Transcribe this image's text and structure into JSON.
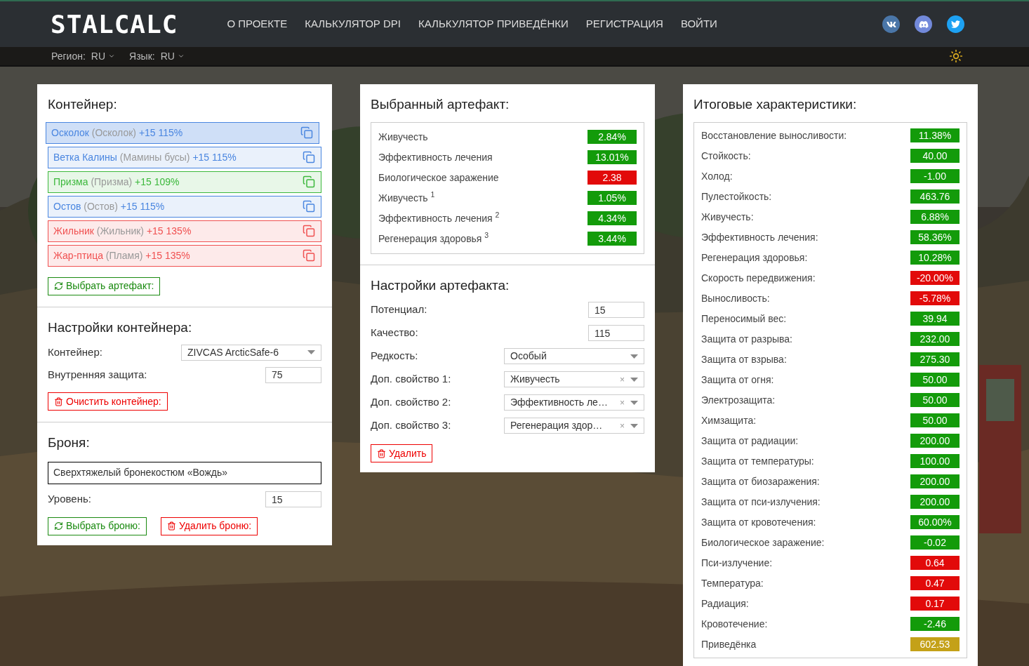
{
  "nav": {
    "logo": "STALCALC",
    "links": [
      "О ПРОЕКТЕ",
      "КАЛЬКУЛЯТОР DPI",
      "КАЛЬКУЛЯТОР ПРИВЕДЁНКИ",
      "РЕГИСТРАЦИЯ",
      "ВОЙТИ"
    ]
  },
  "subbar": {
    "region_label": "Регион:",
    "region": "RU",
    "language_label": "Язык:",
    "language": "RU"
  },
  "container_panel": {
    "title": "Контейнер:",
    "artifacts": [
      {
        "name": "Осколок",
        "alt": "(Осколок)",
        "level": "+15 115%",
        "color": "#4a86e0",
        "selected": true
      },
      {
        "name": "Ветка Калины",
        "alt": "(Мамины бусы)",
        "level": "+15 115%",
        "color": "#4a86e0",
        "selected": false
      },
      {
        "name": "Призма",
        "alt": "(Призма)",
        "level": "+15 109%",
        "color": "#3cb83c",
        "selected": false
      },
      {
        "name": "Остов",
        "alt": "(Остов)",
        "level": "+15 115%",
        "color": "#4a86e0",
        "selected": false
      },
      {
        "name": "Жильник",
        "alt": "(Жильник)",
        "level": "+15 135%",
        "color": "#f05050",
        "selected": false
      },
      {
        "name": "Жар-птица",
        "alt": "(Пламя)",
        "level": "+15 135%",
        "color": "#f05050",
        "selected": false
      }
    ],
    "choose_button": "Выбрать артефакт:"
  },
  "container_settings": {
    "title": "Настройки контейнера:",
    "container_label": "Контейнер:",
    "container_value": "ZIVCAS ArcticSafe-6",
    "protection_label": "Внутренняя защита:",
    "protection_value": "75",
    "clear_button": "Очистить контейнер:"
  },
  "armor": {
    "title": "Броня:",
    "name": "Сверхтяжелый бронекостюм «Вождь»",
    "level_label": "Уровень:",
    "level_value": "15",
    "choose_button": "Выбрать броню:",
    "delete_button": "Удалить броню:"
  },
  "selected_artifact": {
    "title": "Выбранный артефакт:",
    "stats": [
      {
        "label": "Живучесть",
        "value": "2.84%",
        "color": "#139b0a"
      },
      {
        "label": "Эффективность лечения",
        "value": "13.01%",
        "color": "#139b0a"
      },
      {
        "label": "Биологическое заражение",
        "value": "2.38",
        "color": "#e20a0a"
      },
      {
        "label": "Живучесть $^{1}$",
        "value": "1.05%",
        "color": "#139b0a"
      },
      {
        "label": "Эффективность лечения $^{2}$",
        "value": "4.34%",
        "color": "#139b0a"
      },
      {
        "label": "Регенерация здоровья $^{3}$",
        "value": "3.44%",
        "color": "#139b0a"
      }
    ]
  },
  "artifact_settings": {
    "title": "Настройки артефакта:",
    "inputs": [
      {
        "label": "Потенциал:",
        "value": "15"
      },
      {
        "label": "Качество:",
        "value": "115"
      }
    ],
    "selects": [
      {
        "label": "Редкость:",
        "value": "Особый",
        "clearable": false
      },
      {
        "label": "Доп. свойство 1:",
        "value": "Живучесть",
        "clearable": true
      },
      {
        "label": "Доп. свойство 2:",
        "value": "Эффективность ле…",
        "clearable": true
      },
      {
        "label": "Доп. свойство 3:",
        "value": "Регенерация здор…",
        "clearable": true
      }
    ],
    "clear_mark": "×",
    "delete_button": "Удалить"
  },
  "totals": {
    "title": "Итоговые характеристики:",
    "stats": [
      {
        "label": "Восстановление выносливости:",
        "value": "11.38%",
        "color": "#139b0a"
      },
      {
        "label": "Стойкость:",
        "value": "40.00",
        "color": "#139b0a"
      },
      {
        "label": "Холод:",
        "value": "-1.00",
        "color": "#139b0a"
      },
      {
        "label": "Пулестойкость:",
        "value": "463.76",
        "color": "#139b0a"
      },
      {
        "label": "Живучесть:",
        "value": "6.88%",
        "color": "#139b0a"
      },
      {
        "label": "Эффективность лечения:",
        "value": "58.36%",
        "color": "#139b0a"
      },
      {
        "label": "Регенерация здоровья:",
        "value": "10.28%",
        "color": "#139b0a"
      },
      {
        "label": "Скорость передвижения:",
        "value": "-20.00%",
        "color": "#e20a0a"
      },
      {
        "label": "Выносливость:",
        "value": "-5.78%",
        "color": "#e20a0a"
      },
      {
        "label": "Переносимый вес:",
        "value": "39.94",
        "color": "#139b0a"
      },
      {
        "label": "Защита от разрыва:",
        "value": "232.00",
        "color": "#139b0a"
      },
      {
        "label": "Защита от взрыва:",
        "value": "275.30",
        "color": "#139b0a"
      },
      {
        "label": "Защита от огня:",
        "value": "50.00",
        "color": "#139b0a"
      },
      {
        "label": "Электрозащита:",
        "value": "50.00",
        "color": "#139b0a"
      },
      {
        "label": "Химзащита:",
        "value": "50.00",
        "color": "#139b0a"
      },
      {
        "label": "Защита от радиации:",
        "value": "200.00",
        "color": "#139b0a"
      },
      {
        "label": "Защита от температуры:",
        "value": "100.00",
        "color": "#139b0a"
      },
      {
        "label": "Защита от биозаражения:",
        "value": "200.00",
        "color": "#139b0a"
      },
      {
        "label": "Защита от пси-излучения:",
        "value": "200.00",
        "color": "#139b0a"
      },
      {
        "label": "Защита от кровотечения:",
        "value": "60.00%",
        "color": "#139b0a"
      },
      {
        "label": "Биологическое заражение:",
        "value": "-0.02",
        "color": "#139b0a"
      },
      {
        "label": "Пси-излучение:",
        "value": "0.64",
        "color": "#e20a0a"
      },
      {
        "label": "Температура:",
        "value": "0.47",
        "color": "#e20a0a"
      },
      {
        "label": "Радиация:",
        "value": "0.17",
        "color": "#e20a0a"
      },
      {
        "label": "Кровотечение:",
        "value": "-2.46",
        "color": "#139b0a"
      },
      {
        "label": "Приведёнка",
        "value": "602.53",
        "color": "#c4a118"
      }
    ]
  }
}
